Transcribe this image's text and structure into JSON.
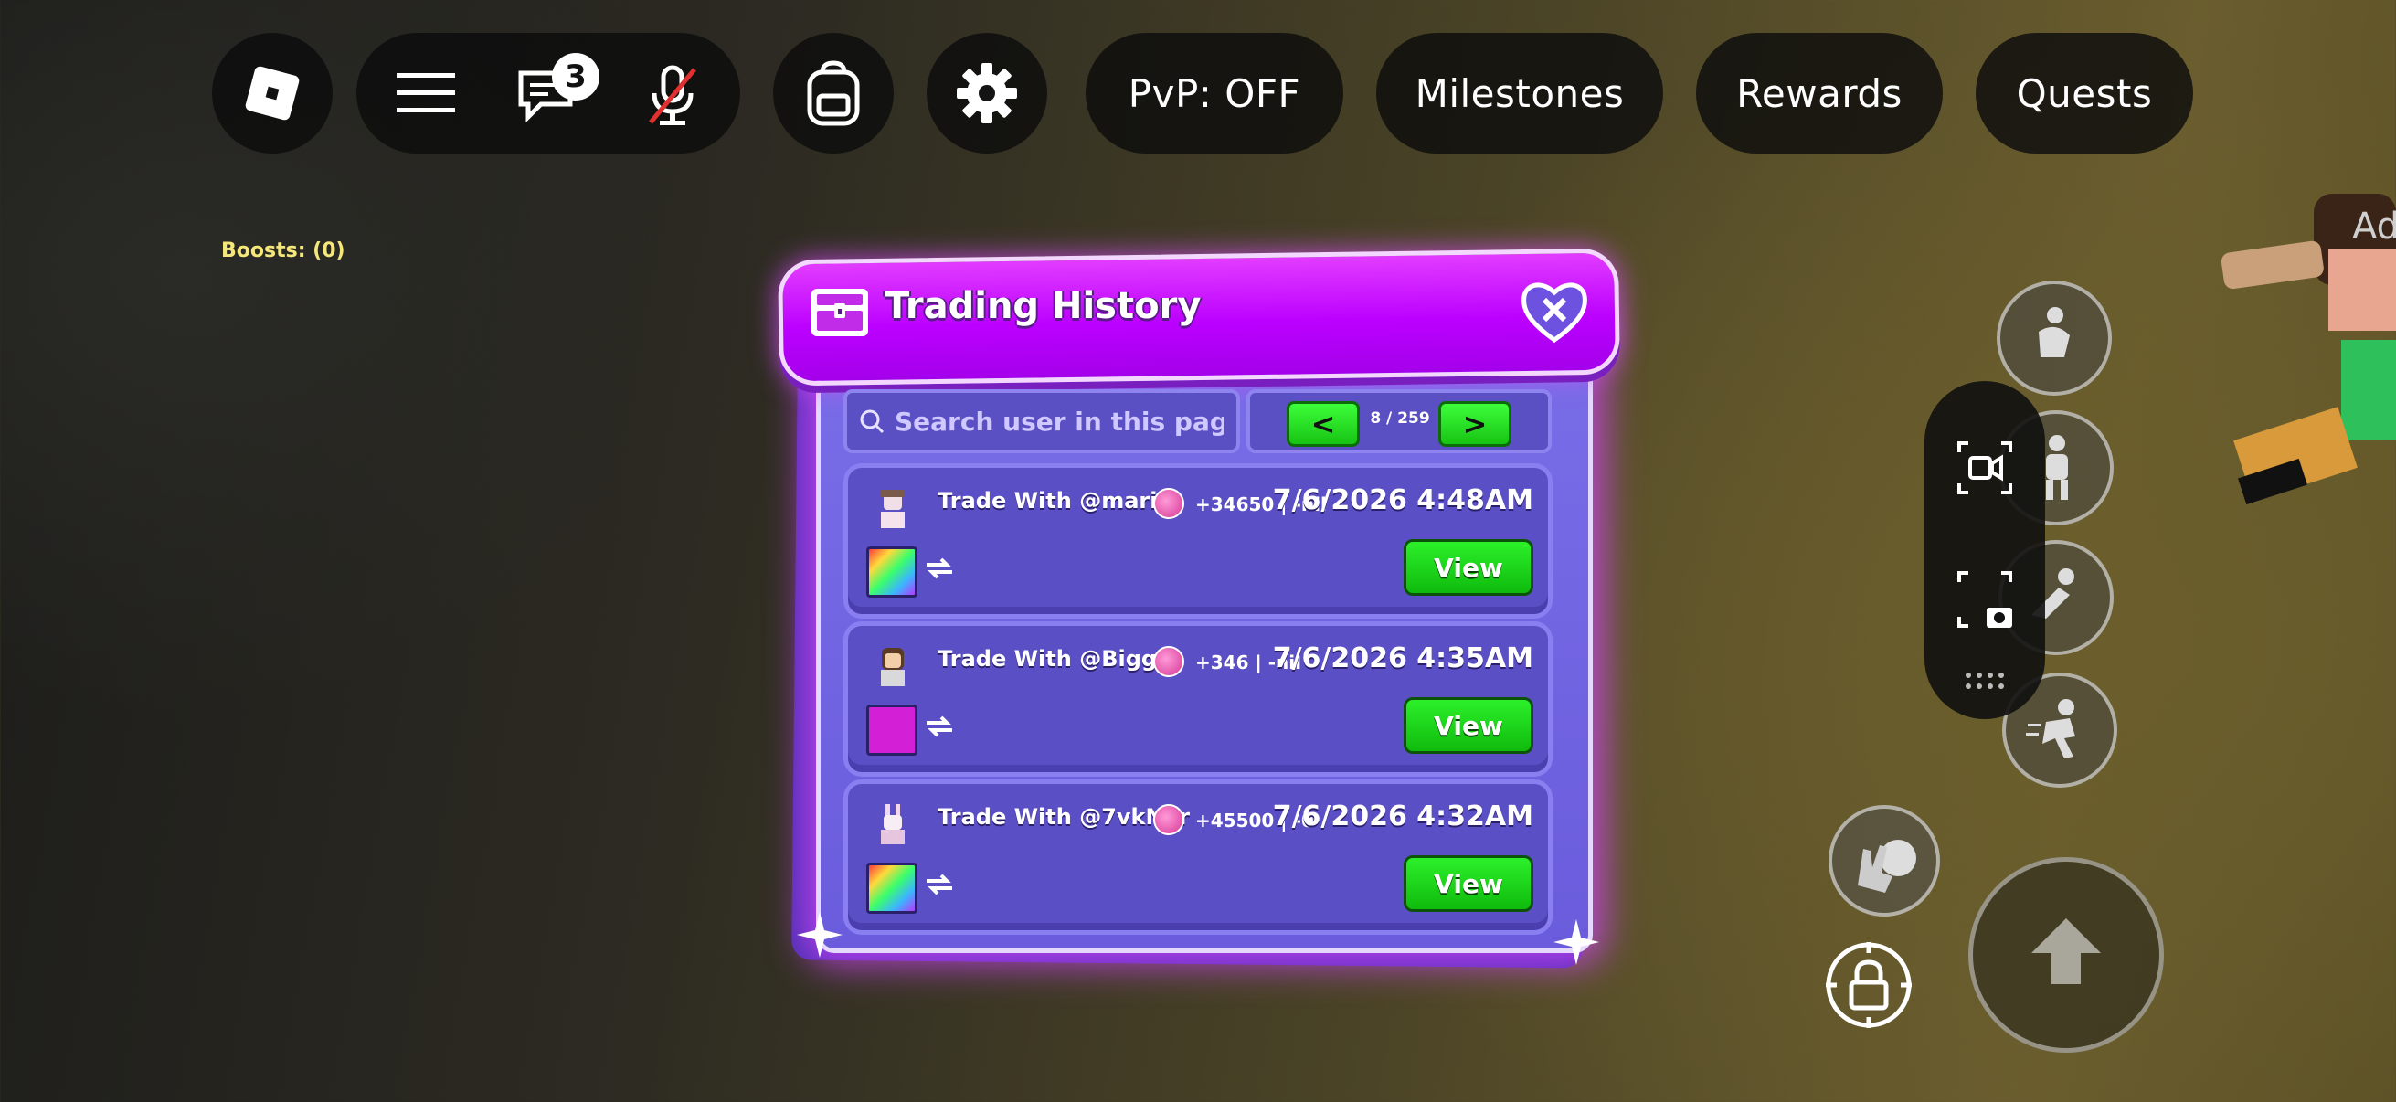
{
  "topbar": {
    "chat_badge": "3",
    "pvp_label": "PvP: OFF",
    "milestones_label": "Milestones",
    "rewards_label": "Rewards",
    "quests_label": "Quests"
  },
  "boosts_label": "Boosts: (0)",
  "trading_history": {
    "title": "Trading History",
    "search_placeholder": "Search user in this page",
    "pager": {
      "prev": "<",
      "next": ">",
      "page_label": "8 / 259"
    },
    "trades": [
      {
        "trade_with": "Trade With @mari",
        "delta": "+34650 | -nil",
        "date": "7/6/2026 4:48AM",
        "view_label": "View",
        "item": "rainbow"
      },
      {
        "trade_with": "Trade With @Biggy",
        "delta": "+346 | -nil",
        "date": "7/6/2026 4:35AM",
        "view_label": "View",
        "item": "magenta"
      },
      {
        "trade_with": "Trade With @7vkNor",
        "delta": "+45500 | -0",
        "date": "7/6/2026 4:32AM",
        "view_label": "View",
        "item": "rainbow"
      }
    ]
  },
  "player_name_fragment": "Ad",
  "colors": {
    "header_purple": "#bb00ff",
    "panel_blue": "#6a5cdc",
    "view_green": "#17c314"
  }
}
